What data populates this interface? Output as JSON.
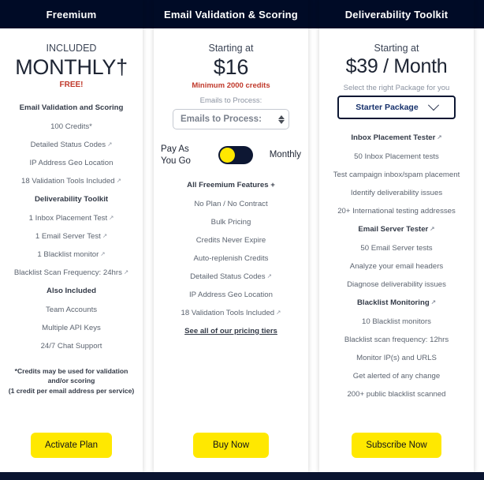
{
  "theme": {
    "navy": "#000b26",
    "yellow": "#ffe800",
    "red": "#c0392b",
    "link_blue": "#16306b"
  },
  "icons": {
    "external_link": "↗",
    "chevron_down": "chevron-down-icon",
    "spinner": "number-spinner-icon"
  },
  "columns": [
    {
      "header": "Freemium",
      "starting_label": "INCLUDED",
      "price": "MONTHLY†",
      "price_note": "FREE!",
      "features": [
        {
          "text": "Email Validation and Scoring",
          "bold": true,
          "ext": false
        },
        {
          "text": "100 Credits*",
          "bold": false,
          "ext": false
        },
        {
          "text": "Detailed Status Codes",
          "bold": false,
          "ext": true
        },
        {
          "text": "IP Address Geo Location",
          "bold": false,
          "ext": false
        },
        {
          "text": "18 Validation Tools Included",
          "bold": false,
          "ext": true
        },
        {
          "text": "Deliverability Toolkit",
          "bold": true,
          "ext": false
        },
        {
          "text": "1 Inbox Placement Test",
          "bold": false,
          "ext": true
        },
        {
          "text": "1 Email Server Test",
          "bold": false,
          "ext": true
        },
        {
          "text": "1 Blacklist monitor",
          "bold": false,
          "ext": true
        },
        {
          "text": "Blacklist Scan Frequency: 24hrs",
          "bold": false,
          "ext": true
        },
        {
          "text": "Also Included",
          "bold": true,
          "ext": false
        },
        {
          "text": "Team Accounts",
          "bold": false,
          "ext": false
        },
        {
          "text": "Multiple API Keys",
          "bold": false,
          "ext": false
        },
        {
          "text": "24/7 Chat Support",
          "bold": false,
          "ext": false
        }
      ],
      "footnote_line1": "*Credits may be used for validation and/or scoring",
      "footnote_line2": "(1 credit per email address per service)",
      "cta": "Activate Plan"
    },
    {
      "header": "Email Validation & Scoring",
      "starting_label": "Starting at",
      "price": "$16",
      "price_note": "Minimum 2000 credits",
      "input_label": "Emails to Process:",
      "input_placeholder": "Emails to Process:",
      "input_value": "",
      "toggle": {
        "left_label": "Pay As You Go",
        "right_label": "Monthly",
        "state": "left"
      },
      "features": [
        {
          "text": "All Freemium Features +",
          "bold": true,
          "ext": false
        },
        {
          "text": "No Plan / No Contract",
          "bold": false,
          "ext": false
        },
        {
          "text": "Bulk Pricing",
          "bold": false,
          "ext": false
        },
        {
          "text": "Credits Never Expire",
          "bold": false,
          "ext": false
        },
        {
          "text": "Auto-replenish Credits",
          "bold": false,
          "ext": false
        },
        {
          "text": "Detailed Status Codes",
          "bold": false,
          "ext": true
        },
        {
          "text": "IP Address Geo Location",
          "bold": false,
          "ext": false
        },
        {
          "text": "18 Validation Tools Included",
          "bold": false,
          "ext": true
        }
      ],
      "pricing_link": "See all of our pricing tiers",
      "cta": "Buy Now"
    },
    {
      "header": "Deliverability Toolkit",
      "starting_label": "Starting at",
      "price": "$39 / Month",
      "select_label": "Select the right Package for you",
      "select_value": "Starter Package",
      "features": [
        {
          "text": "Inbox Placement Tester",
          "bold": true,
          "ext": true
        },
        {
          "text": "50 Inbox Placement tests",
          "bold": false,
          "ext": false
        },
        {
          "text": "Test campaign inbox/spam placement",
          "bold": false,
          "ext": false
        },
        {
          "text": "Identify deliverability issues",
          "bold": false,
          "ext": false
        },
        {
          "text": "20+ International testing addresses",
          "bold": false,
          "ext": false
        },
        {
          "text": "Email Server Tester",
          "bold": true,
          "ext": true
        },
        {
          "text": "50 Email Server tests",
          "bold": false,
          "ext": false
        },
        {
          "text": "Analyze your email headers",
          "bold": false,
          "ext": false
        },
        {
          "text": "Diagnose deliverability issues",
          "bold": false,
          "ext": false
        },
        {
          "text": "Blacklist Monitoring",
          "bold": true,
          "ext": true
        },
        {
          "text": "10 Blacklist monitors",
          "bold": false,
          "ext": false
        },
        {
          "text": "Blacklist scan frequency: 12hrs",
          "bold": false,
          "ext": false
        },
        {
          "text": "Monitor IP(s) and URLS",
          "bold": false,
          "ext": false
        },
        {
          "text": "Get alerted of any change",
          "bold": false,
          "ext": false
        },
        {
          "text": "200+ public blacklist scanned",
          "bold": false,
          "ext": false
        }
      ],
      "cta": "Subscribe Now"
    }
  ]
}
